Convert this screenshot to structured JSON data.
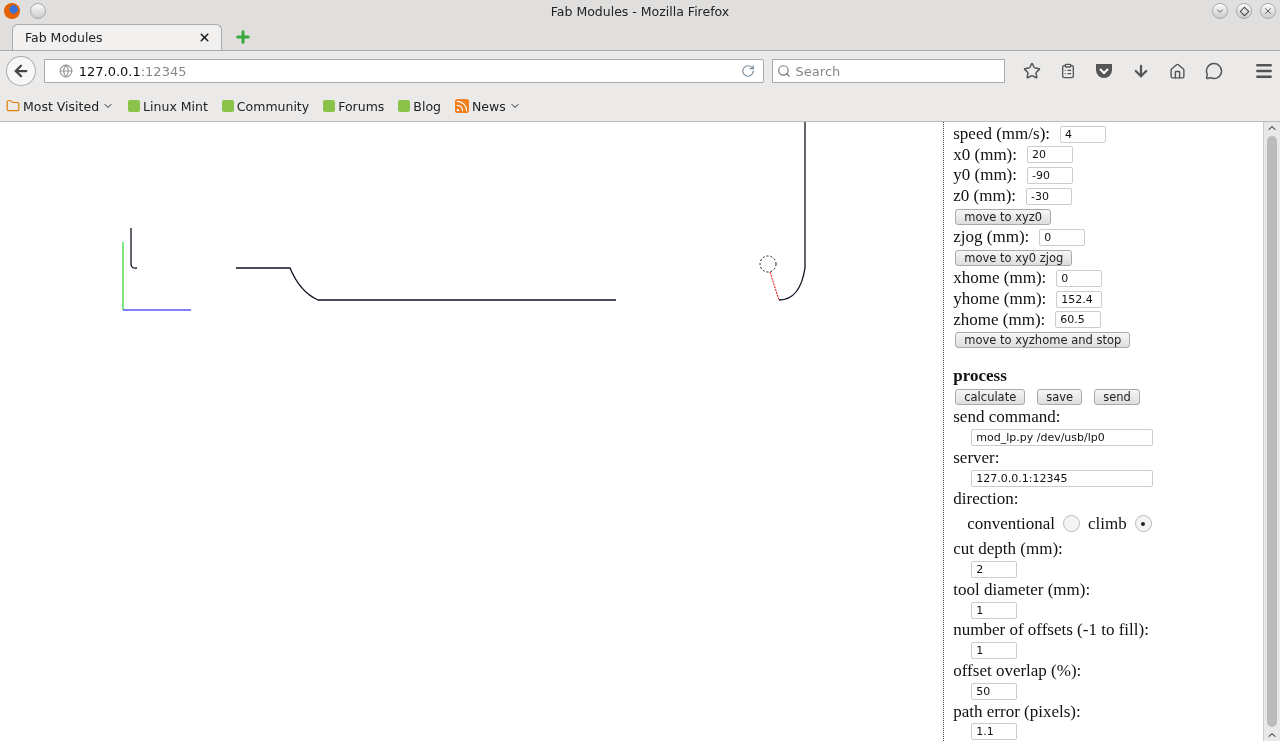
{
  "window": {
    "title": "Fab Modules - Mozilla Firefox"
  },
  "tabs": [
    {
      "label": "Fab Modules",
      "selected": true
    }
  ],
  "address": {
    "host": "127.0.0.1",
    "port": ":12345"
  },
  "search": {
    "placeholder": "Search"
  },
  "bookmarks": [
    {
      "label": "Most Visited",
      "kind": "folder"
    },
    {
      "label": "Linux Mint",
      "kind": "mint"
    },
    {
      "label": "Community",
      "kind": "mint"
    },
    {
      "label": "Forums",
      "kind": "mint"
    },
    {
      "label": "Blog",
      "kind": "mint"
    },
    {
      "label": "News",
      "kind": "feed"
    }
  ],
  "panel": {
    "items": [
      {
        "kind": "inline",
        "label": "speed (mm/s):",
        "value": "4"
      },
      {
        "kind": "inline",
        "label": "x0 (mm):",
        "value": "20"
      },
      {
        "kind": "inline",
        "label": "y0 (mm):",
        "value": "-90"
      },
      {
        "kind": "inline",
        "label": "z0 (mm):",
        "value": "-30"
      },
      {
        "kind": "button",
        "label": "move to xyz0"
      },
      {
        "kind": "inline",
        "label": "zjog (mm):",
        "value": "0"
      },
      {
        "kind": "button",
        "label": "move to xy0 zjog"
      },
      {
        "kind": "inline",
        "label": "xhome (mm):",
        "value": "0"
      },
      {
        "kind": "inline",
        "label": "yhome (mm):",
        "value": "152.4"
      },
      {
        "kind": "inline",
        "label": "zhome (mm):",
        "value": "60.5"
      },
      {
        "kind": "button",
        "label": "move to xyzhome and stop"
      },
      {
        "kind": "heading",
        "label": "process"
      },
      {
        "kind": "buttons",
        "buttons": [
          "calculate",
          "save",
          "send"
        ]
      },
      {
        "kind": "wide",
        "label": "send command:",
        "value": "mod_lp.py /dev/usb/lp0"
      },
      {
        "kind": "wide",
        "label": "server:",
        "value": "127.0.0.1:12345"
      },
      {
        "kind": "radio",
        "label": "direction:",
        "options": [
          {
            "label": "conventional",
            "selected": false
          },
          {
            "label": "climb",
            "selected": true
          }
        ]
      },
      {
        "kind": "narrow",
        "label": "cut depth (mm):",
        "value": "2"
      },
      {
        "kind": "narrow",
        "label": "tool diameter (mm):",
        "value": "1"
      },
      {
        "kind": "narrow",
        "label": "number of offsets (-1 to fill):",
        "value": "1"
      },
      {
        "kind": "narrow",
        "label": "offset overlap (%):",
        "value": "50"
      },
      {
        "kind": "narrow",
        "label": "path error (pixels):",
        "value": "1.1"
      }
    ]
  }
}
